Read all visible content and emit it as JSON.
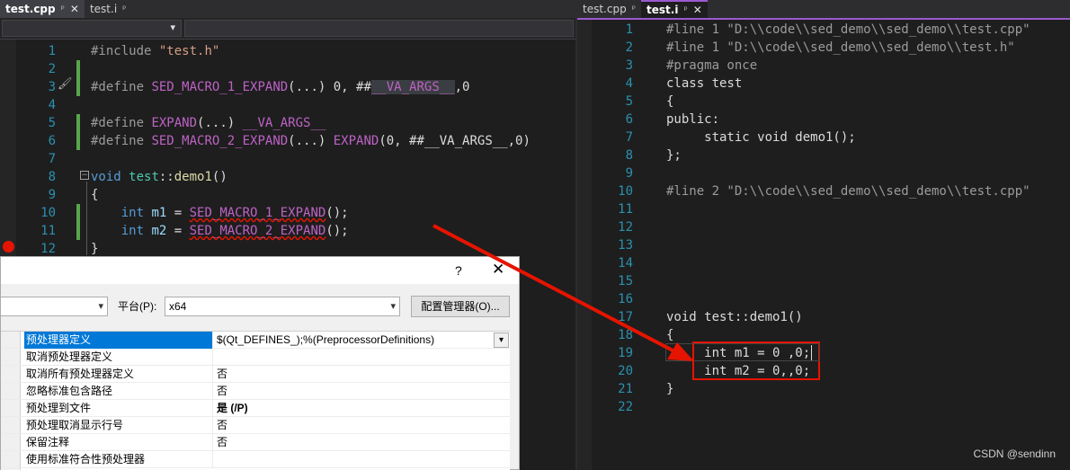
{
  "left_editor": {
    "tabs": [
      {
        "label": "test.cpp",
        "pin": "ᵖ",
        "close": "✕"
      },
      {
        "label": "test.i",
        "pin": "ᵖ"
      }
    ],
    "lines": [
      {
        "n": "1"
      },
      {
        "n": "2"
      },
      {
        "n": "3"
      },
      {
        "n": "4"
      },
      {
        "n": "5"
      },
      {
        "n": "6"
      },
      {
        "n": "7"
      },
      {
        "n": "8"
      },
      {
        "n": "9"
      },
      {
        "n": "10"
      },
      {
        "n": "11"
      },
      {
        "n": "12"
      }
    ]
  },
  "right_editor": {
    "tabs": [
      {
        "label": "test.cpp",
        "pin": "ᵖ"
      },
      {
        "label": "test.i",
        "pin": "ᵖ",
        "close": "✕"
      }
    ],
    "line_numbers": [
      "1",
      "2",
      "3",
      "4",
      "5",
      "6",
      "7",
      "8",
      "9",
      "10",
      "11",
      "12",
      "13",
      "14",
      "15",
      "16",
      "17",
      "18",
      "19",
      "20",
      "21",
      "22"
    ],
    "code": [
      "#line 1 \"D:\\\\code\\\\sed_demo\\\\sed_demo\\\\test.cpp\"",
      "#line 1 \"D:\\\\code\\\\sed_demo\\\\sed_demo\\\\test.h\"",
      "#pragma once",
      "class test",
      "{",
      "public:",
      "     static void demo1();",
      "};",
      "",
      "#line 2 \"D:\\\\code\\\\sed_demo\\\\sed_demo\\\\test.cpp\"",
      "",
      "",
      "",
      "",
      "",
      "",
      "void test::demo1()",
      "{",
      "     int m1 = 0 ,0;",
      "     int m2 = 0,,0;",
      "}",
      ""
    ]
  },
  "dialog": {
    "help": "?",
    "close": "✕",
    "platform_label": "平台(P):",
    "platform_value": "x64",
    "config_manager_button": "配置管理器(O)...",
    "rows": [
      {
        "key": "预处理器定义",
        "value": "$(Qt_DEFINES_);%(PreprocessorDefinitions)",
        "bold": false
      },
      {
        "key": "取消预处理器定义",
        "value": "",
        "bold": false
      },
      {
        "key": "取消所有预处理器定义",
        "value": "否",
        "bold": false
      },
      {
        "key": "忽略标准包含路径",
        "value": "否",
        "bold": false
      },
      {
        "key": "预处理到文件",
        "value": "是 (/P)",
        "bold": true
      },
      {
        "key": "预处理取消显示行号",
        "value": "否",
        "bold": false
      },
      {
        "key": "保留注释",
        "value": "否",
        "bold": false
      },
      {
        "key": "使用标准符合性预处理器",
        "value": "",
        "bold": false
      }
    ]
  },
  "credit": "CSDN @sendinn",
  "colors": {
    "annotation_red": "#e51400",
    "tab_accent_purple": "#9b59d0",
    "line_number_blue": "#2b91af",
    "macro_purple": "#bd63c5"
  }
}
